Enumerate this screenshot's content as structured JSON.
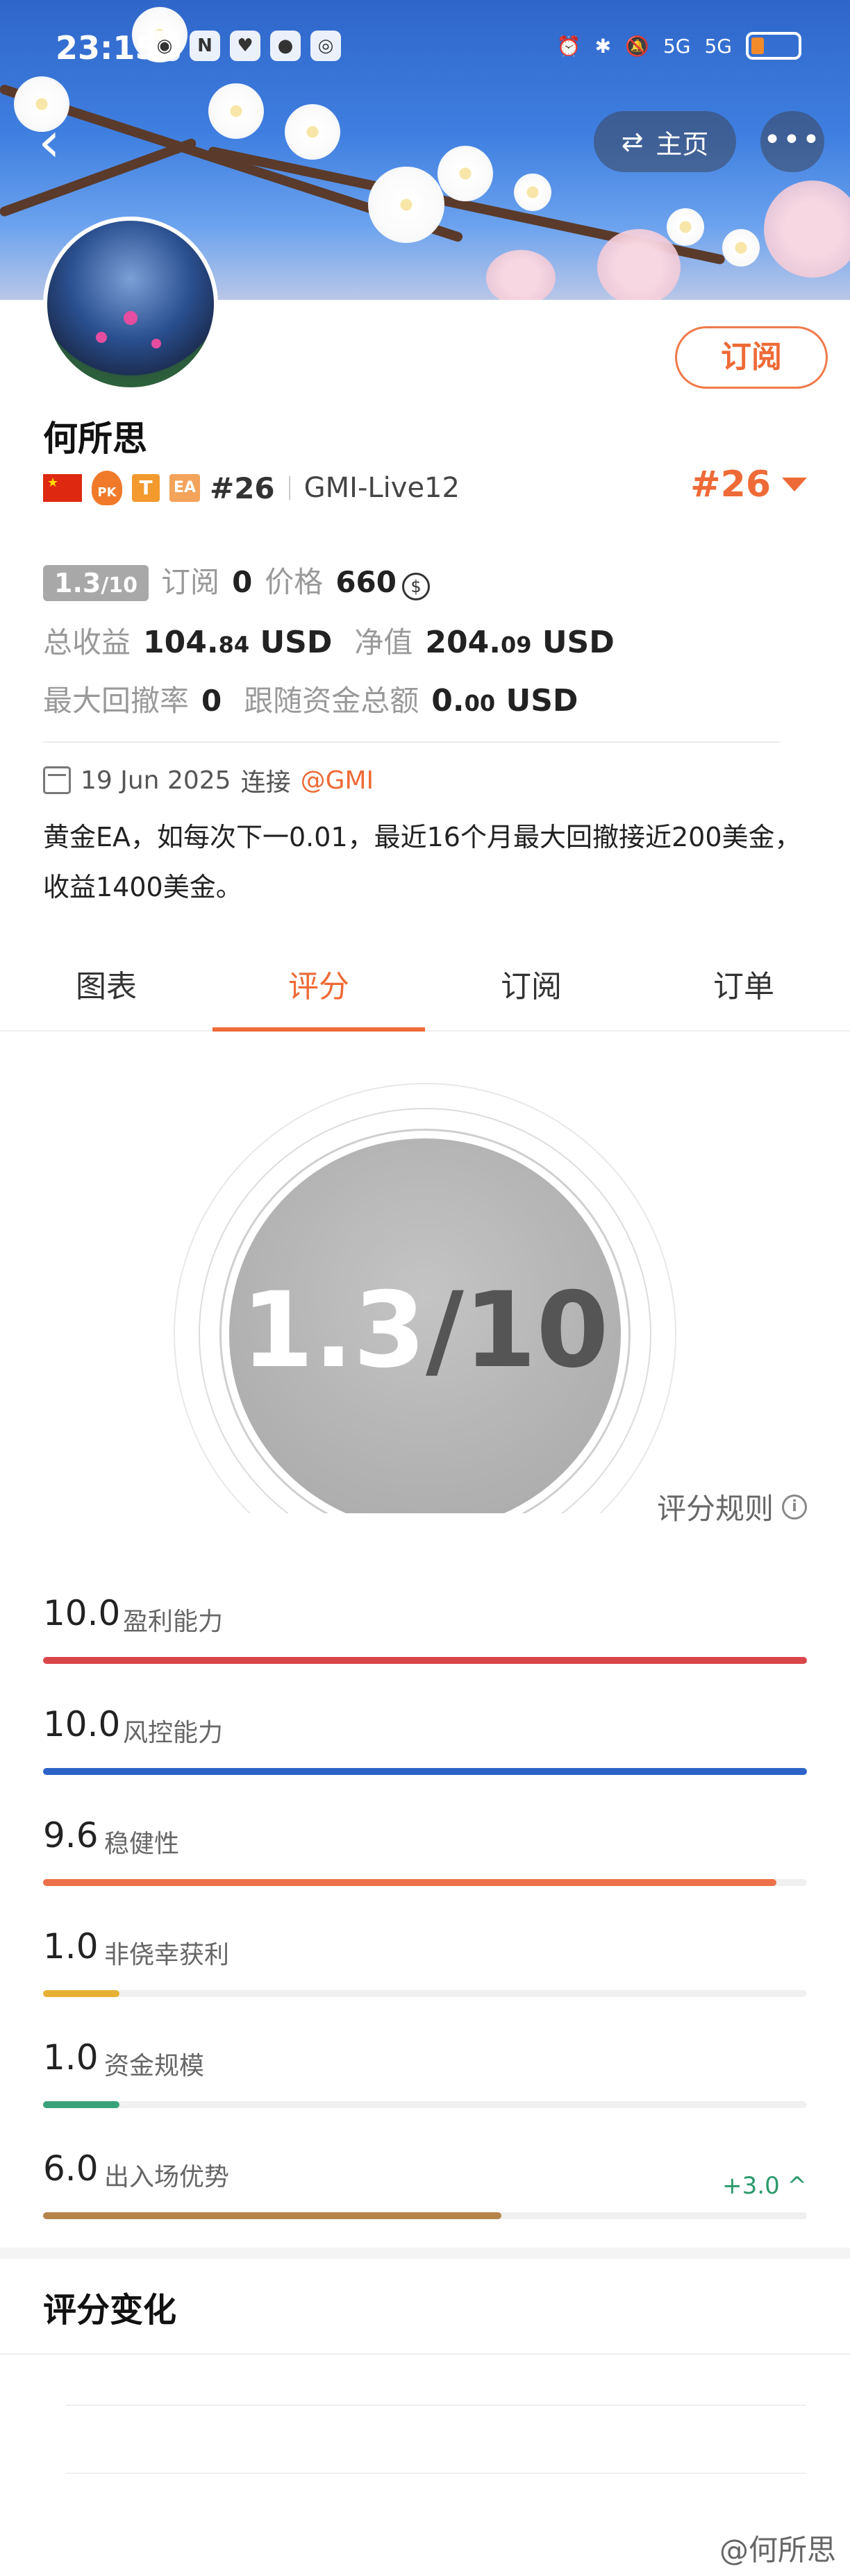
{
  "status_bar": {
    "time": "23:15",
    "signal1": "5G",
    "signal2": "5G"
  },
  "header": {
    "home_label": "主页",
    "more_label": "•••",
    "subscribe_label": "订阅"
  },
  "profile": {
    "name": "何所思",
    "rank_inline": "#26",
    "server": "GMI-Live12",
    "rank_right": "#26",
    "badges": {
      "pk": "PK",
      "t": "T",
      "ea": "EA"
    }
  },
  "stats": {
    "score_main": "1.3",
    "score_max": "/10",
    "subscriptions_label": "订阅",
    "subscriptions_value": "0",
    "price_label": "价格",
    "price_value": "660",
    "total_profit_label": "总收益",
    "total_profit_int": "104.",
    "total_profit_dec": "84",
    "total_profit_unit": "USD",
    "net_value_label": "净值",
    "net_value_int": "204.",
    "net_value_dec": "09",
    "net_value_unit": "USD",
    "max_drawdown_label": "最大回撤率",
    "max_drawdown_value": "0",
    "follow_funds_label": "跟随资金总额",
    "follow_funds_int": "0.",
    "follow_funds_dec": "00",
    "follow_funds_unit": "USD"
  },
  "connection": {
    "date": "19 Jun 2025",
    "label": "连接",
    "broker": "@GMI"
  },
  "description": "黄金EA，如每次下一0.01，最近16个月最大回撤接近200美金，收益1400美金。",
  "tabs": [
    {
      "label": "图表"
    },
    {
      "label": "评分"
    },
    {
      "label": "订阅"
    },
    {
      "label": "订单"
    }
  ],
  "score_circle": {
    "value": "1.3",
    "max": "/10"
  },
  "rules_label": "评分规则",
  "metrics": [
    {
      "value": "10.0",
      "label": "盈利能力",
      "score": 10.0,
      "color": "#d9464a"
    },
    {
      "value": "10.0",
      "label": "风控能力",
      "score": 10.0,
      "color": "#2d63c8"
    },
    {
      "value": "9.6",
      "label": "稳健性",
      "score": 9.6,
      "color": "#ec7048"
    },
    {
      "value": "1.0",
      "label": "非侥幸获利",
      "score": 1.0,
      "color": "#e6b133"
    },
    {
      "value": "1.0",
      "label": "资金规模",
      "score": 1.0,
      "color": "#3aa27a"
    },
    {
      "value": "6.0",
      "label": "出入场优势",
      "score": 6.0,
      "color": "#b5844b",
      "delta": "+3.0 ^"
    }
  ],
  "score_change_title": "评分变化",
  "watermark": "@何所思"
}
